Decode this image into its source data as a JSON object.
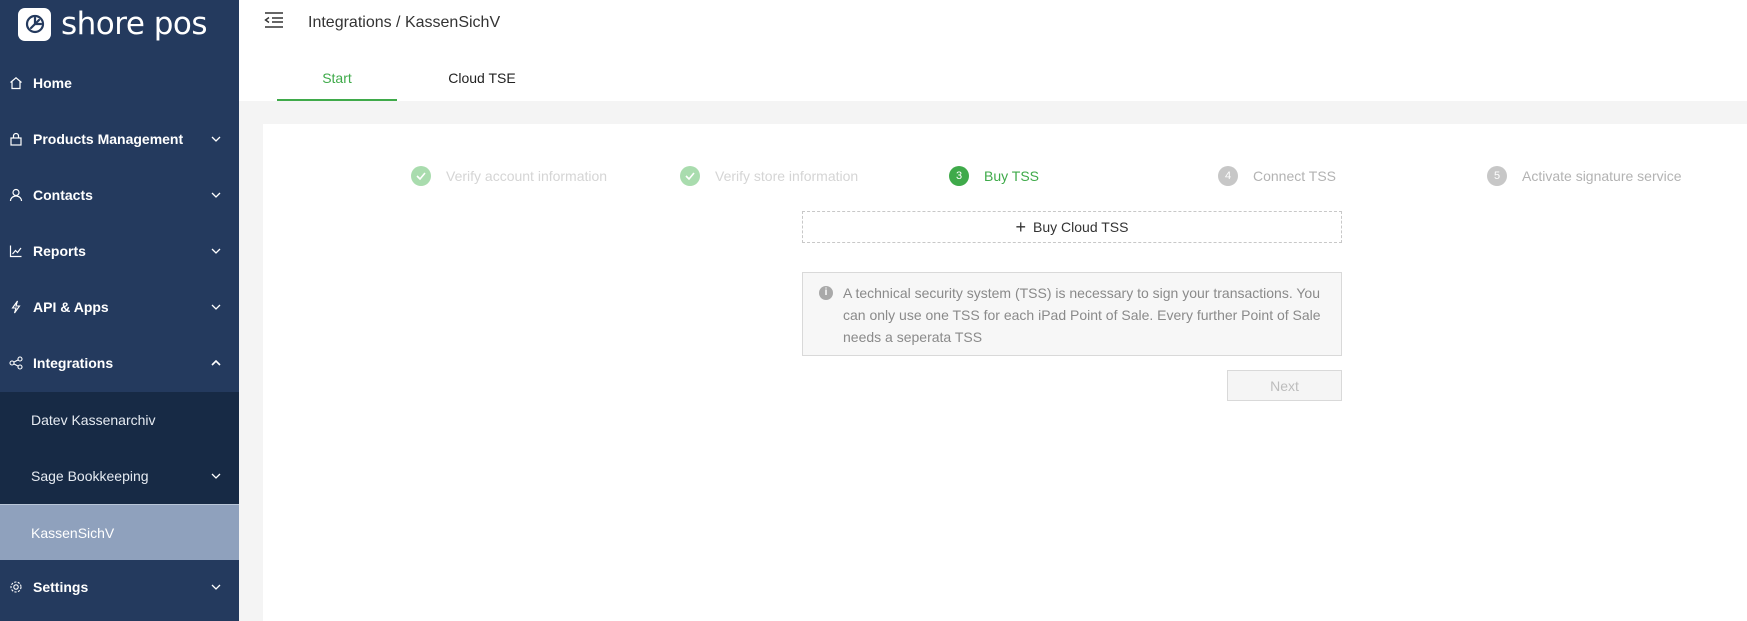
{
  "brand": {
    "logo_text": "shore pos"
  },
  "sidebar": {
    "items": [
      {
        "label": "Home"
      },
      {
        "label": "Products Management"
      },
      {
        "label": "Contacts"
      },
      {
        "label": "Reports"
      },
      {
        "label": "API & Apps"
      },
      {
        "label": "Integrations"
      },
      {
        "label": "Settings"
      }
    ],
    "integrations_submenu": [
      {
        "label": "Datev Kassenarchiv"
      },
      {
        "label": "Sage Bookkeeping"
      },
      {
        "label": "KassenSichV"
      }
    ]
  },
  "header": {
    "breadcrumb": "Integrations / KassenSichV"
  },
  "tabs": [
    {
      "label": "Start"
    },
    {
      "label": "Cloud TSE"
    }
  ],
  "steps": [
    {
      "number": "",
      "label": "Verify account information",
      "status": "done"
    },
    {
      "number": "",
      "label": "Verify store information",
      "status": "done"
    },
    {
      "number": "3",
      "label": "Buy TSS",
      "status": "current"
    },
    {
      "number": "4",
      "label": "Connect TSS",
      "status": "todo"
    },
    {
      "number": "5",
      "label": "Activate signature service",
      "status": "todo"
    }
  ],
  "buy_button": {
    "label": "Buy Cloud TSS"
  },
  "info": {
    "text": "A technical security system (TSS) is necessary to sign your transactions. You can only use one TSS for each iPad Point of Sale. Every further Point of Sale needs a seperata TSS"
  },
  "next_button": {
    "label": "Next"
  },
  "colors": {
    "sidebar_bg": "#243a5e",
    "submenu_bg": "#172a45",
    "active_item": "#8fa1bd",
    "accent_green": "#3faa4a"
  }
}
